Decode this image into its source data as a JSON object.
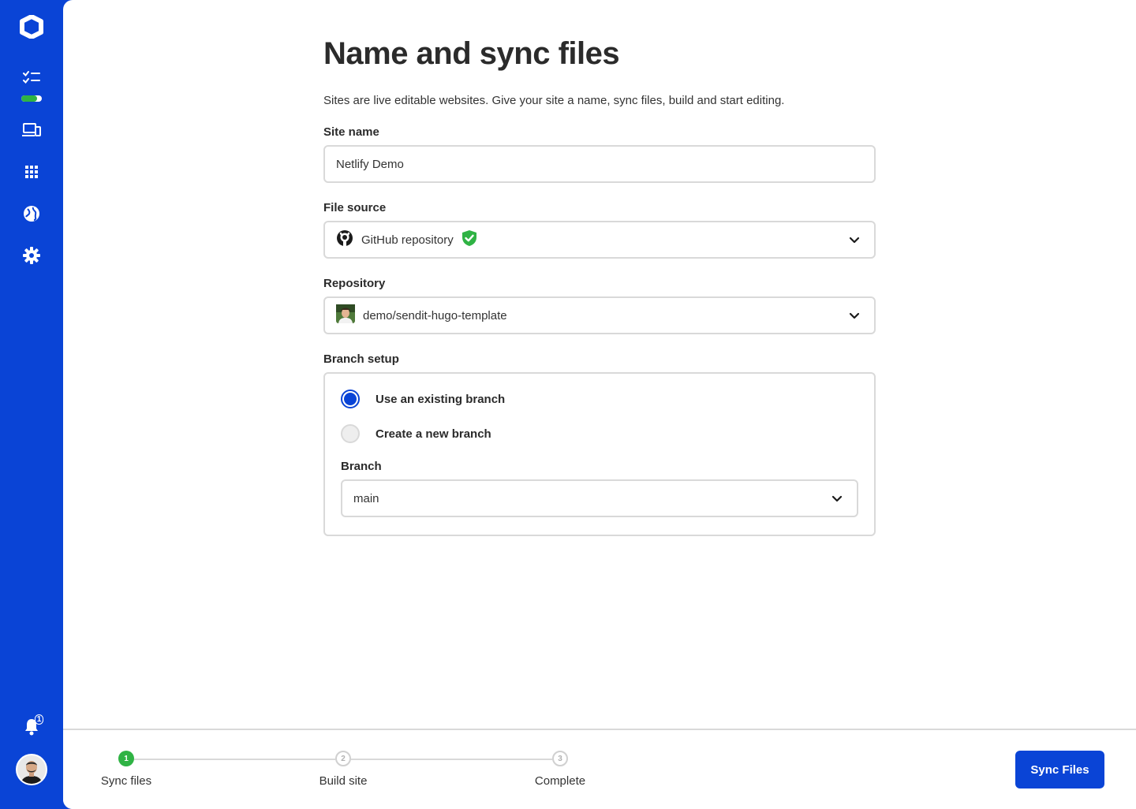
{
  "page": {
    "title": "Name and sync files",
    "subtitle": "Sites are live editable websites. Give your site a name, sync files, build and start editing."
  },
  "sidebar": {
    "items": [
      {
        "icon": "checklist-icon"
      },
      {
        "icon": "devices-icon"
      },
      {
        "icon": "apps-grid-icon"
      },
      {
        "icon": "globe-icon"
      },
      {
        "icon": "gear-icon"
      }
    ],
    "progress_fraction": 0.75,
    "notifications_count": "1"
  },
  "form": {
    "site_name": {
      "label": "Site name",
      "value": "Netlify Demo"
    },
    "file_source": {
      "label": "File source",
      "value": "GitHub repository",
      "verified_icon": "shield-check-icon"
    },
    "repository": {
      "label": "Repository",
      "value": "demo/sendit-hugo-template"
    },
    "branch_setup": {
      "label": "Branch setup",
      "options": [
        {
          "label": "Use an existing branch",
          "selected": true
        },
        {
          "label": "Create a new branch",
          "selected": false
        }
      ],
      "branch": {
        "label": "Branch",
        "value": "main"
      }
    }
  },
  "stepper": {
    "steps": [
      {
        "number": "1",
        "label": "Sync files",
        "status": "current"
      },
      {
        "number": "2",
        "label": "Build site",
        "status": "todo"
      },
      {
        "number": "3",
        "label": "Complete",
        "status": "todo"
      }
    ]
  },
  "actions": {
    "sync_label": "Sync Files"
  },
  "colors": {
    "brand": "#0a44d6",
    "success": "#2fb344",
    "border": "#d9d9d9"
  }
}
